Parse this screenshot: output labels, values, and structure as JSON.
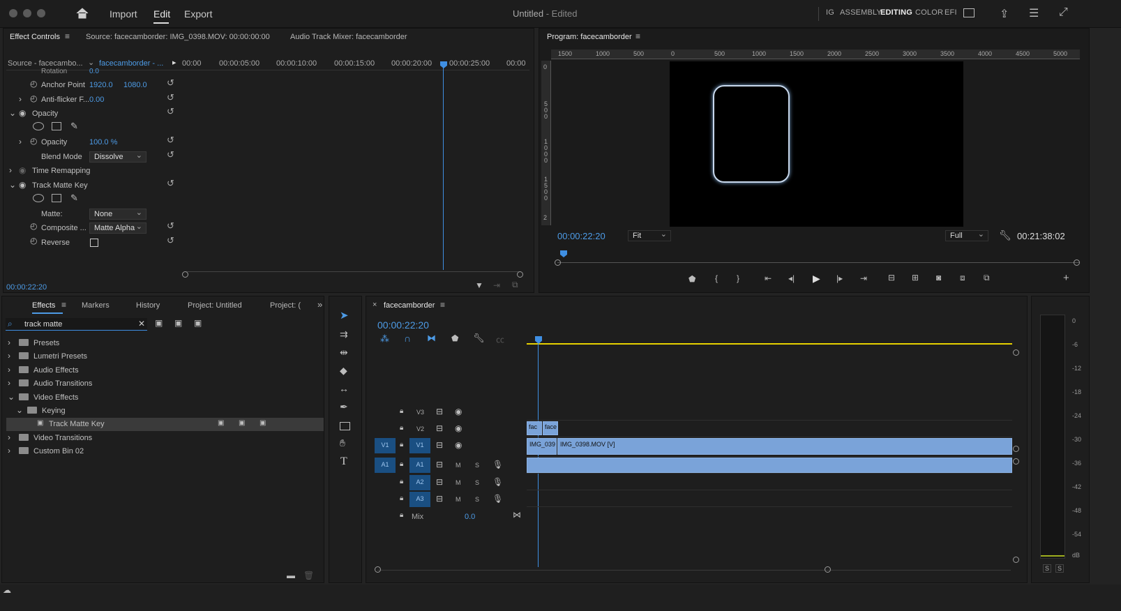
{
  "titlebar": {
    "menu": [
      "Import",
      "Edit",
      "Export"
    ],
    "title": "Untitled",
    "title_suffix": "- Edited",
    "workspaces": [
      "IG",
      "ASSEMBLY",
      "EDITING",
      "COLOR",
      "EFI"
    ]
  },
  "effect_controls": {
    "tab": "Effect Controls",
    "source_label": "Source: facecamborder: IMG_0398.MOV: 00:00:00:00",
    "mixer_label": "Audio Track Mixer: facecamborder",
    "source_dropdown": "Source - facecambo...",
    "seq_dropdown": "facecamborder - ...",
    "ruler": [
      "00:00",
      "00:00:05:00",
      "00:00:10:00",
      "00:00:15:00",
      "00:00:20:00",
      "00:00:25:00",
      "00:00"
    ],
    "rows": {
      "rotation": "Rotation",
      "rotation_val": "0.0",
      "anchor": "Anchor Point",
      "anchor_x": "1920.0",
      "anchor_y": "1080.0",
      "antiflicker": "Anti-flicker F...",
      "antiflicker_val": "0.00",
      "opacity_group": "Opacity",
      "opacity": "Opacity",
      "opacity_val": "100.0 %",
      "blend": "Blend Mode",
      "blend_val": "Dissolve",
      "time_remap": "Time Remapping",
      "tmk": "Track Matte Key",
      "matte": "Matte:",
      "matte_val": "None",
      "composite": "Composite ...",
      "composite_val": "Matte Alpha",
      "reverse": "Reverse"
    },
    "timecode": "00:00:22:20"
  },
  "program": {
    "title": "Program: facecamborder",
    "timecode": "00:00:22:20",
    "fit": "Fit",
    "quality": "Full",
    "duration": "00:21:38:02",
    "ruler": [
      "1500",
      "1000",
      "500",
      "0",
      "500",
      "1000",
      "1500",
      "2000",
      "2500",
      "3000",
      "3500",
      "4000",
      "4500",
      "5000"
    ],
    "vruler": [
      "0",
      "500",
      "1000",
      "1500",
      "2"
    ]
  },
  "effects": {
    "tabs": [
      "Effects",
      "Markers",
      "History",
      "Project: Untitled",
      "Project: ("
    ],
    "search": "track matte",
    "tree": [
      "Presets",
      "Lumetri Presets",
      "Audio Effects",
      "Audio Transitions",
      "Video Effects",
      "Keying",
      "Track Matte Key",
      "Video Transitions",
      "Custom Bin 02"
    ]
  },
  "timeline": {
    "title": "facecamborder",
    "timecode": "00:00:22:20",
    "tracks": {
      "v3": "V3",
      "v2": "V2",
      "v1": "V1",
      "a1": "A1",
      "a2": "A2",
      "a3": "A3",
      "mix": "Mix",
      "mix_val": "0.0",
      "m": "M",
      "s": "S"
    },
    "clips": {
      "v2a": "fac",
      "v2b": "face",
      "v1": "IMG_039",
      "v1b": "IMG_0398.MOV [V]"
    }
  },
  "meter": {
    "scale": [
      "0",
      "-6",
      "-12",
      "-18",
      "-24",
      "-30",
      "-36",
      "-42",
      "-48",
      "-54",
      "dB"
    ],
    "solo": [
      "S",
      "S"
    ]
  }
}
